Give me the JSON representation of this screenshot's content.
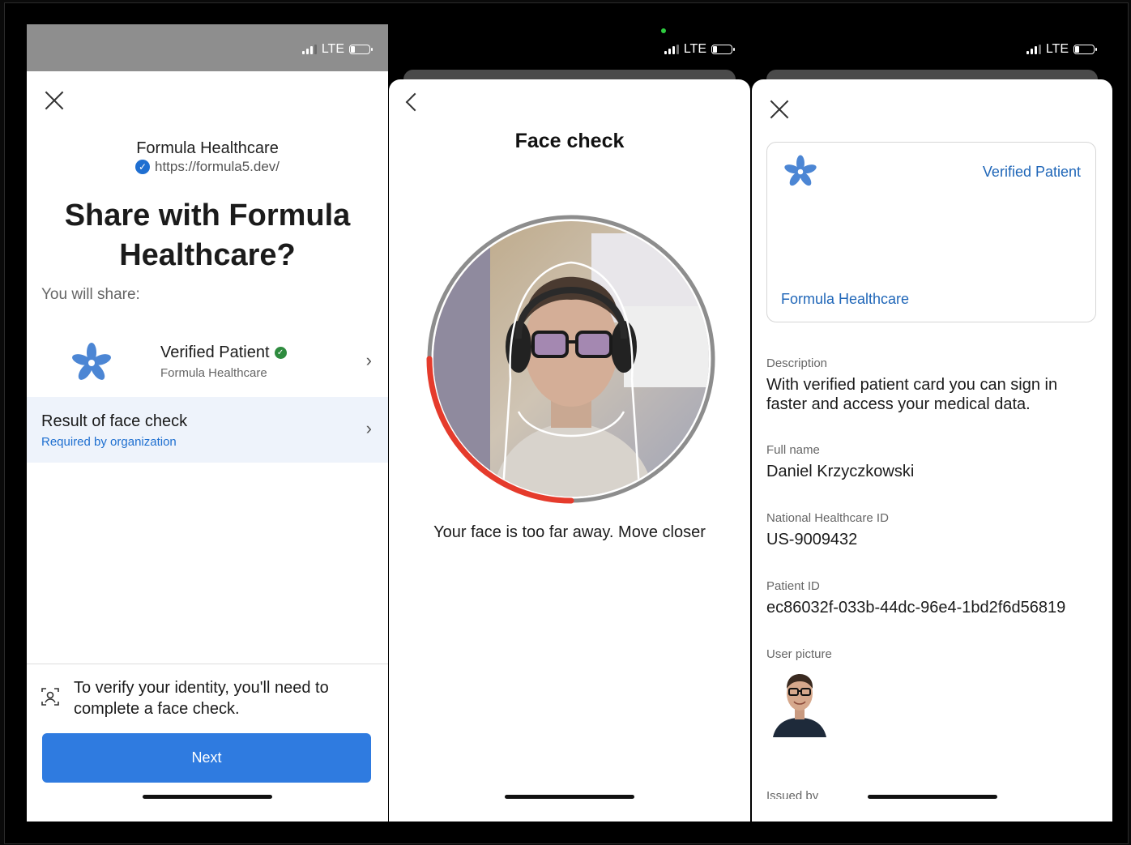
{
  "status": {
    "network": "LTE"
  },
  "screen1": {
    "org_name": "Formula Healthcare",
    "org_url": "https://formula5.dev/",
    "title": "Share with Formula Healthcare?",
    "you_will_share": "You will share:",
    "credential": {
      "title": "Verified Patient",
      "issuer": "Formula Healthcare"
    },
    "face_check": {
      "title": "Result of face check",
      "subtitle": "Required by organization"
    },
    "verify_note": "To verify your identity, you'll need to complete a face check.",
    "next_label": "Next"
  },
  "screen2": {
    "title": "Face check",
    "hint": "Your face is too far away. Move closer",
    "progress": 0.25
  },
  "screen3": {
    "card": {
      "type": "Verified Patient",
      "org": "Formula Healthcare"
    },
    "fields": [
      {
        "label": "Description",
        "value": "With verified patient card you can sign in faster and access your medical data."
      },
      {
        "label": "Full name",
        "value": "Daniel Krzyczkowski"
      },
      {
        "label": "National Healthcare ID",
        "value": "US-9009432"
      },
      {
        "label": "Patient ID",
        "value": "ec86032f-033b-44dc-96e4-1bd2f6d56819"
      },
      {
        "label": "User picture"
      },
      {
        "label": "Issued by"
      }
    ]
  },
  "colors": {
    "accent": "#2f7be0",
    "link": "#1f66b8",
    "progress": "#e53b2c",
    "verified": "#2e8b3e"
  }
}
